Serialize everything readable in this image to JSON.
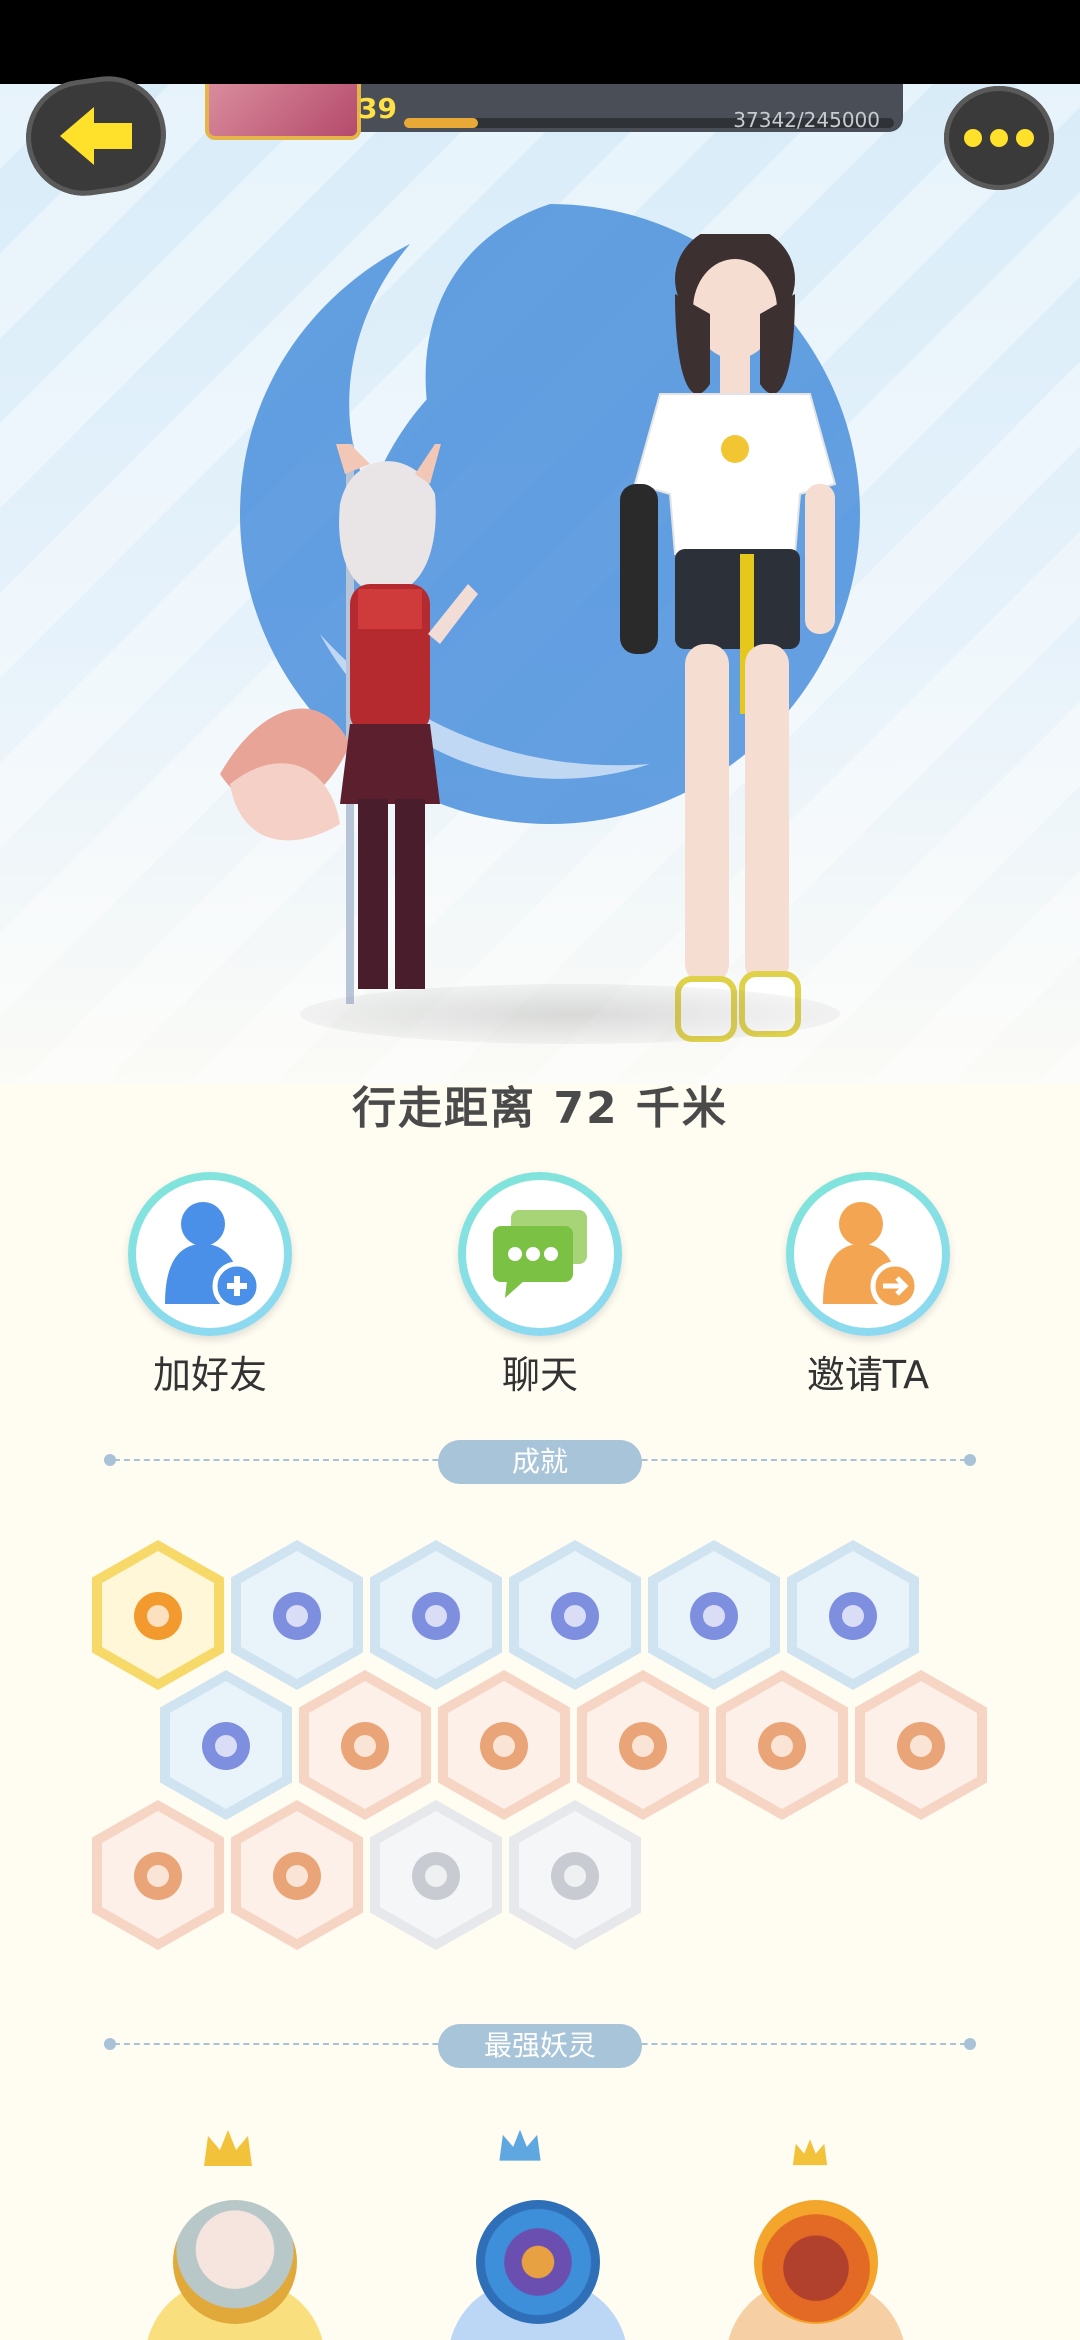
{
  "header": {
    "level": "39",
    "exp_text": "37342/245000",
    "exp_progress": 0.152
  },
  "hero": {
    "distance_text": "行走距离 72 千米"
  },
  "actions": [
    {
      "label": "加好友",
      "icon": "add-friend-icon",
      "color": "#4a8fe8"
    },
    {
      "label": "聊天",
      "icon": "chat-icon",
      "color": "#7bc143"
    },
    {
      "label": "邀请TA",
      "icon": "invite-icon",
      "color": "#f3a552"
    }
  ],
  "sections": {
    "achievements_title": "成就",
    "strongest_title": "最强妖灵"
  },
  "achievements": [
    {
      "icon": "cat-face-badge-icon",
      "tier": "gold"
    },
    {
      "icon": "purple-orb-badge-icon",
      "tier": "blue"
    },
    {
      "icon": "moon-badge-icon",
      "tier": "blue"
    },
    {
      "icon": "crystal-ball-badge-icon",
      "tier": "blue"
    },
    {
      "icon": "yin-yang-wave-badge-icon",
      "tier": "blue"
    },
    {
      "icon": "yin-yang-cube-badge-icon",
      "tier": "blue"
    },
    {
      "icon": "purple-orb-shield-badge-icon",
      "tier": "blue"
    },
    {
      "icon": "sneaker-badge-icon",
      "tier": "orange"
    },
    {
      "icon": "crystal-egg-badge-icon",
      "tier": "orange"
    },
    {
      "icon": "gingerbread-badge-icon",
      "tier": "orange"
    },
    {
      "icon": "cat-stroller-badge-icon",
      "tier": "orange"
    },
    {
      "icon": "fox-balloon-badge-icon",
      "tier": "orange"
    },
    {
      "icon": "horned-creature-badge-icon",
      "tier": "orange"
    },
    {
      "icon": "bear-badge-icon",
      "tier": "orange"
    },
    {
      "icon": "crowned-dragon-badge-icon",
      "tier": "gray"
    },
    {
      "icon": "fox-book-badge-icon",
      "tier": "gray"
    }
  ],
  "strongest_spirits": [
    {
      "icon": "silver-hair-girl-avatar",
      "crown": "gold-crown-icon"
    },
    {
      "icon": "crystal-beast-avatar",
      "crown": "blue-crown-icon"
    },
    {
      "icon": "fire-lion-avatar",
      "crown": "gold-crown-icon"
    }
  ],
  "colors": {
    "accent_yellow": "#ffe12c",
    "divider": "#a9c3d6",
    "ring_teal": "#7fe6d8"
  }
}
